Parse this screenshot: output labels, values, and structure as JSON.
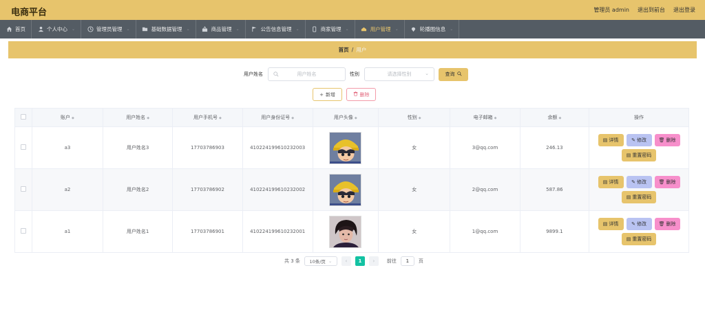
{
  "header": {
    "title": "电商平台",
    "user_label": "管理员 admin",
    "exit_front": "退出到前台",
    "logout": "退出登录"
  },
  "nav": {
    "items": [
      {
        "label": "首页",
        "icon": "home-icon"
      },
      {
        "label": "个人中心",
        "icon": "user-icon"
      },
      {
        "label": "管理员管理",
        "icon": "clock-icon"
      },
      {
        "label": "基础数据管理",
        "icon": "folder-icon"
      },
      {
        "label": "商品管理",
        "icon": "goods-icon"
      },
      {
        "label": "公告信息管理",
        "icon": "flag-icon"
      },
      {
        "label": "商家管理",
        "icon": "phone-icon"
      },
      {
        "label": "用户管理",
        "icon": "user-group-icon"
      },
      {
        "label": "轮播图信息",
        "icon": "location-icon"
      }
    ],
    "active_color": "#e7c46c"
  },
  "breadcrumb": {
    "home": "首页",
    "separator": "/",
    "current": "用户"
  },
  "search": {
    "name_label": "用户姓名",
    "name_placeholder": "用户姓名",
    "sex_label": "性别",
    "sex_placeholder": "请选择性别",
    "query_label": "查询"
  },
  "actions": {
    "add_label": "新增",
    "delete_label": "删除"
  },
  "table": {
    "columns": [
      "账户",
      "用户姓名",
      "用户手机号",
      "用户身份证号",
      "用户头像",
      "性别",
      "电子邮箱",
      "余额",
      "操作"
    ],
    "rows": [
      {
        "account": "a3",
        "name": "用户姓名3",
        "phone": "17703786903",
        "idcard": "410224199610232003",
        "avatar": "cartoon-boy-avatar",
        "sex": "女",
        "email": "3@qq.com",
        "balance": "246.13"
      },
      {
        "account": "a2",
        "name": "用户姓名2",
        "phone": "17703786902",
        "idcard": "410224199610232002",
        "avatar": "cartoon-boy-avatar",
        "sex": "女",
        "email": "2@qq.com",
        "balance": "587.86"
      },
      {
        "account": "a1",
        "name": "用户姓名1",
        "phone": "17703786901",
        "idcard": "410224199610232001",
        "avatar": "photo-person-avatar",
        "sex": "女",
        "email": "1@qq.com",
        "balance": "9899.1"
      }
    ],
    "ops": {
      "detail": "详情",
      "edit": "修改",
      "delete": "删除",
      "reset": "重置密码"
    }
  },
  "pagination": {
    "total_text": "共 3 条",
    "page_size": "10条/页",
    "current_page": "1",
    "goto_label": "前往",
    "goto_value": "1",
    "page_unit": "页"
  }
}
